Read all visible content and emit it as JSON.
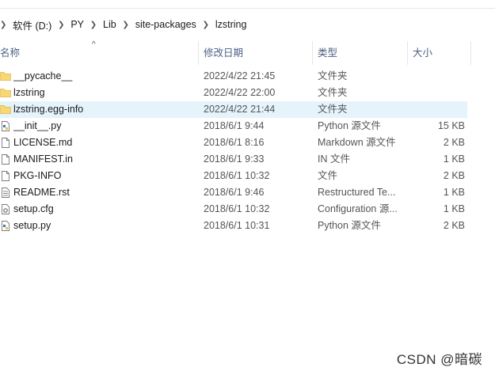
{
  "breadcrumb": [
    "软件 (D:)",
    "PY",
    "Lib",
    "site-packages",
    "lzstring"
  ],
  "columns": {
    "name": "名称",
    "date": "修改日期",
    "type": "类型",
    "size": "大小"
  },
  "rows": [
    {
      "name": "__pycache__",
      "date": "2022/4/22 21:45",
      "type": "文件夹",
      "size": "",
      "icon": "folder-icon"
    },
    {
      "name": "lzstring",
      "date": "2022/4/22 22:00",
      "type": "文件夹",
      "size": "",
      "icon": "folder-icon"
    },
    {
      "name": "lzstring.egg-info",
      "date": "2022/4/22 21:44",
      "type": "文件夹",
      "size": "",
      "icon": "folder-icon",
      "selected": true
    },
    {
      "name": "__init__.py",
      "date": "2018/6/1 9:44",
      "type": "Python 源文件",
      "size": "15 KB",
      "icon": "python-file-icon"
    },
    {
      "name": "LICENSE.md",
      "date": "2018/6/1 8:16",
      "type": "Markdown 源文件",
      "size": "2 KB",
      "icon": "file-icon"
    },
    {
      "name": "MANIFEST.in",
      "date": "2018/6/1 9:33",
      "type": "IN 文件",
      "size": "1 KB",
      "icon": "file-icon"
    },
    {
      "name": "PKG-INFO",
      "date": "2018/6/1 10:32",
      "type": "文件",
      "size": "2 KB",
      "icon": "file-icon"
    },
    {
      "name": "README.rst",
      "date": "2018/6/1 9:46",
      "type": "Restructured Te...",
      "size": "1 KB",
      "icon": "text-file-icon"
    },
    {
      "name": "setup.cfg",
      "date": "2018/6/1 10:32",
      "type": "Configuration 源...",
      "size": "1 KB",
      "icon": "config-file-icon"
    },
    {
      "name": "setup.py",
      "date": "2018/6/1 10:31",
      "type": "Python 源文件",
      "size": "2 KB",
      "icon": "python-file-icon"
    }
  ],
  "watermark": "CSDN @暗碳",
  "colors": {
    "selected_row": "#e5f3fb",
    "folder": "#f8d775",
    "header_text": "#4d6185"
  }
}
